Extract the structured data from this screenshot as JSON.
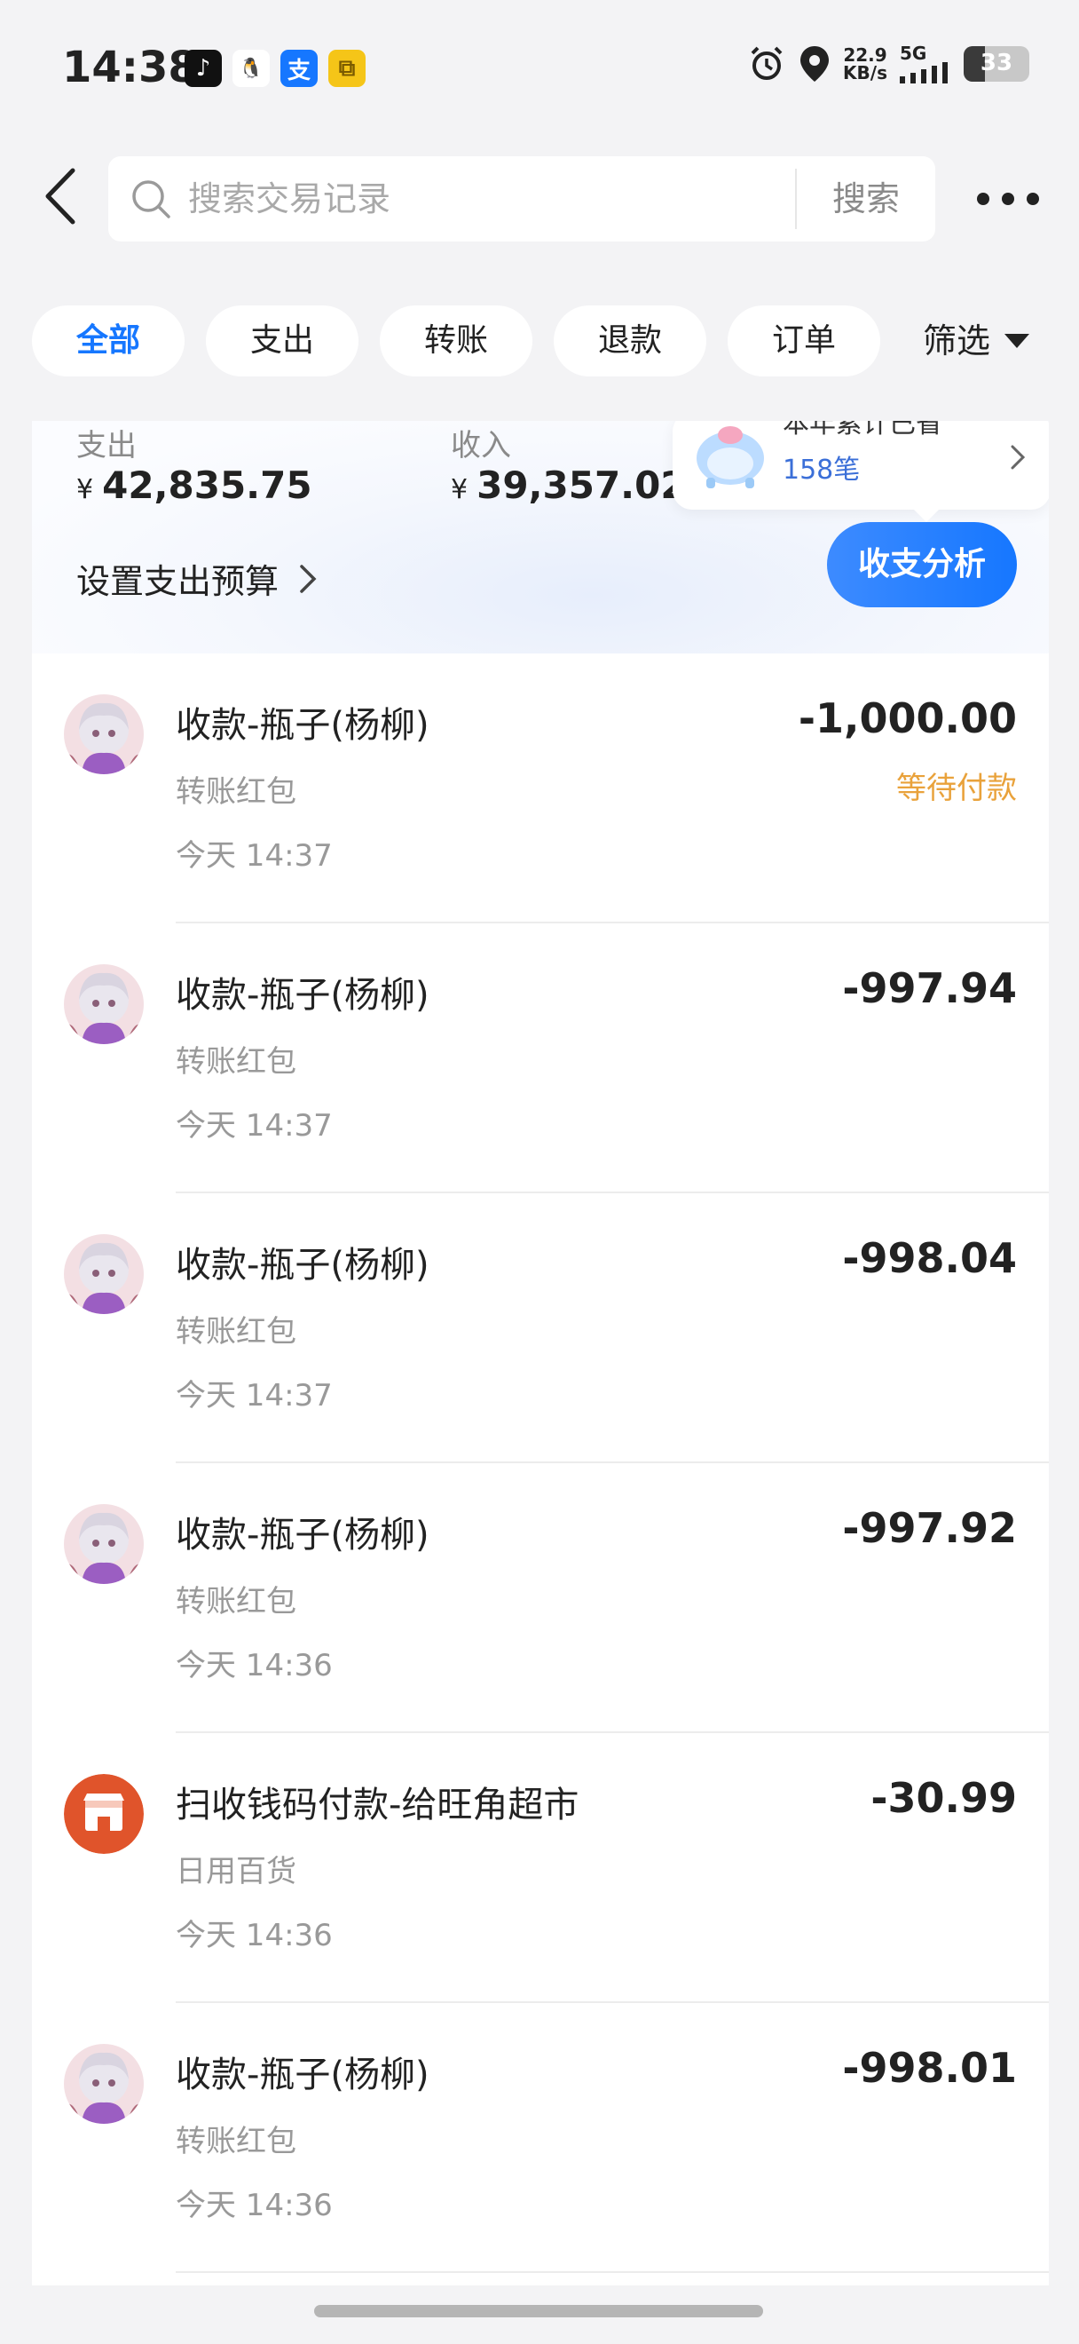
{
  "status_bar": {
    "time": "14:38",
    "app_icons": [
      {
        "name": "douyin-icon",
        "glyph": "♪",
        "color": "#111111"
      },
      {
        "name": "qq-icon",
        "glyph": "🐧",
        "color": "#ffffff"
      },
      {
        "name": "alipay-icon",
        "glyph": "支",
        "color": "#1677ff"
      },
      {
        "name": "copy-app-icon",
        "glyph": "⧉",
        "color": "#f5c518"
      }
    ],
    "net_speed": "22.9",
    "net_unit": "KB/s",
    "network": "5G",
    "battery": "33",
    "battery_level": 0.33
  },
  "header": {
    "search_placeholder": "搜索交易记录",
    "search_button": "搜索"
  },
  "tabs": [
    {
      "label": "全部",
      "active": true
    },
    {
      "label": "支出",
      "active": false
    },
    {
      "label": "转账",
      "active": false
    },
    {
      "label": "退款",
      "active": false
    },
    {
      "label": "订单",
      "active": false
    }
  ],
  "filter_label": "筛选",
  "summary": {
    "expense_label": "支出",
    "expense_currency": "¥",
    "expense_value": "42,835.75",
    "income_label": "收入",
    "income_currency": "¥",
    "income_value": "39,357.02",
    "bill_title": "本年累计已省",
    "bill_count": "158笔",
    "budget_label": "设置支出预算",
    "analysis_button": "收支分析"
  },
  "transactions": [
    {
      "title": "收款-瓶子(杨柳)",
      "category": "转账红包",
      "time": "今天 14:37",
      "amount": "-1,000.00",
      "status": "等待付款",
      "avatar": "anime"
    },
    {
      "title": "收款-瓶子(杨柳)",
      "category": "转账红包",
      "time": "今天 14:37",
      "amount": "-997.94",
      "status": "",
      "avatar": "anime"
    },
    {
      "title": "收款-瓶子(杨柳)",
      "category": "转账红包",
      "time": "今天 14:37",
      "amount": "-998.04",
      "status": "",
      "avatar": "anime"
    },
    {
      "title": "收款-瓶子(杨柳)",
      "category": "转账红包",
      "time": "今天 14:36",
      "amount": "-997.92",
      "status": "",
      "avatar": "anime"
    },
    {
      "title": "扫收钱码付款-给旺角超市",
      "category": "日用百货",
      "time": "今天 14:36",
      "amount": "-30.99",
      "status": "",
      "avatar": "shop"
    },
    {
      "title": "收款-瓶子(杨柳)",
      "category": "转账红包",
      "time": "今天 14:36",
      "amount": "-998.01",
      "status": "",
      "avatar": "anime"
    }
  ],
  "colors": {
    "accent": "#1677ff",
    "pending": "#e9a23b",
    "shop_icon": "#e0542b"
  }
}
